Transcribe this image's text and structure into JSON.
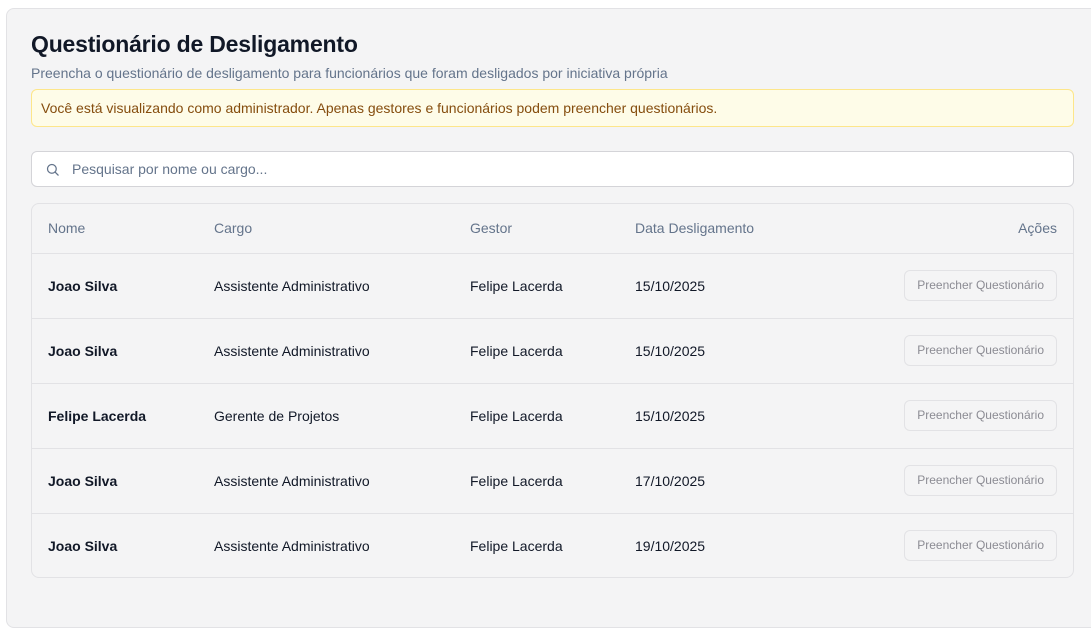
{
  "page": {
    "title": "Questionário de Desligamento",
    "subtitle": "Preencha o questionário de desligamento para funcionários que foram desligados por iniciativa própria"
  },
  "alert": {
    "text": "Você está visualizando como administrador. Apenas gestores e funcionários podem preencher questionários."
  },
  "search": {
    "placeholder": "Pesquisar por nome ou cargo...",
    "value": "",
    "icon": "search-icon"
  },
  "table": {
    "columns": {
      "nome": "Nome",
      "cargo": "Cargo",
      "gestor": "Gestor",
      "data": "Data Desligamento",
      "acoes": "Ações"
    },
    "action_label": "Preencher Questionário",
    "rows": [
      {
        "nome": "Joao Silva",
        "cargo": "Assistente Administrativo",
        "gestor": "Felipe Lacerda",
        "data": "15/10/2025"
      },
      {
        "nome": "Joao Silva",
        "cargo": "Assistente Administrativo",
        "gestor": "Felipe Lacerda",
        "data": "15/10/2025"
      },
      {
        "nome": "Felipe Lacerda",
        "cargo": "Gerente de Projetos",
        "gestor": "Felipe Lacerda",
        "data": "15/10/2025"
      },
      {
        "nome": "Joao Silva",
        "cargo": "Assistente Administrativo",
        "gestor": "Felipe Lacerda",
        "data": "17/10/2025"
      },
      {
        "nome": "Joao Silva",
        "cargo": "Assistente Administrativo",
        "gestor": "Felipe Lacerda",
        "data": "19/10/2025"
      }
    ]
  },
  "colors": {
    "title": "#111827",
    "muted": "#64748b",
    "alert_bg": "#fefce8",
    "alert_border": "#fde68a",
    "alert_text": "#854d0e",
    "card_bg": "#f4f4f5"
  }
}
